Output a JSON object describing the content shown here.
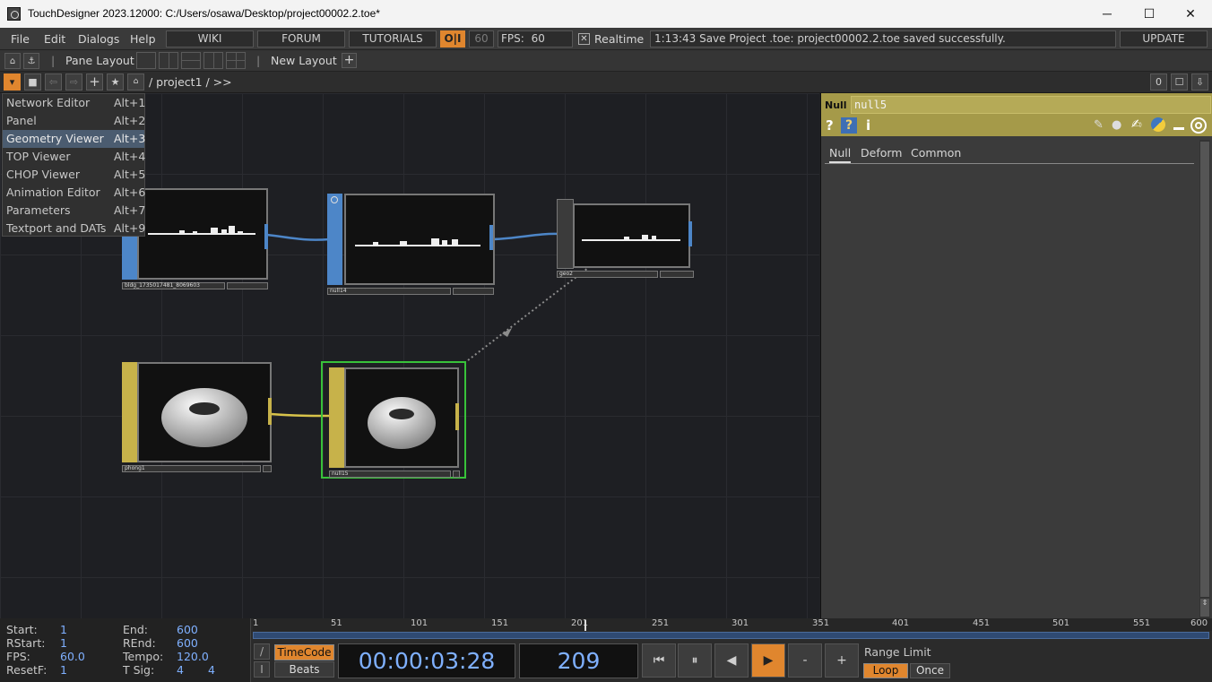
{
  "window": {
    "title": "TouchDesigner 2023.12000: C:/Users/osawa/Desktop/project00002.2.toe*",
    "minimize": "─",
    "maximize": "☐",
    "close": "✕"
  },
  "menu": {
    "file": "File",
    "edit": "Edit",
    "dialogs": "Dialogs",
    "help": "Help",
    "wiki": "WIKI",
    "forum": "FORUM",
    "tutorials": "TUTORIALS",
    "oi": "O|I",
    "fps_box": "60",
    "fps_label": "FPS:",
    "fps_value": "60",
    "realtime_check": "✕",
    "realtime": "Realtime",
    "status": "1:13:43 Save Project .toe: project00002.2.toe saved successfully.",
    "update": "UPDATE"
  },
  "layoutbar": {
    "pane_layout": "Pane Layout",
    "new_layout": "New Layout",
    "plus": "+"
  },
  "pathbar": {
    "path": "/ project1 / >>",
    "counter": "0"
  },
  "dialogs_menu": [
    {
      "label": "Network Editor",
      "key": "Alt+1"
    },
    {
      "label": "Panel",
      "key": "Alt+2"
    },
    {
      "label": "Geometry Viewer",
      "key": "Alt+3"
    },
    {
      "label": "TOP Viewer",
      "key": "Alt+4"
    },
    {
      "label": "CHOP Viewer",
      "key": "Alt+5"
    },
    {
      "label": "Animation Editor",
      "key": "Alt+6"
    },
    {
      "label": "Parameters",
      "key": "Alt+7"
    },
    {
      "label": "Textport and DATs",
      "key": "Alt+9"
    }
  ],
  "nodes": {
    "bldg": "bldg_1735017481_8069603",
    "null14": "null14",
    "geo2": "geo2",
    "phong1": "phong1",
    "null15": "null15"
  },
  "params": {
    "type": "Null",
    "name": "null5",
    "help1": "?",
    "help2": "?",
    "info": "i",
    "tabs": [
      "Null",
      "Deform",
      "Common"
    ]
  },
  "timebar": {
    "start_label": "Start:",
    "start": "1",
    "end_label": "End:",
    "end": "600",
    "rstart_label": "RStart:",
    "rstart": "1",
    "rend_label": "REnd:",
    "rend": "600",
    "fps_label": "FPS:",
    "fps": "60.0",
    "tempo_label": "Tempo:",
    "tempo": "120.0",
    "resetf_label": "ResetF:",
    "resetf": "1",
    "tsig_label": "T Sig:",
    "tsig_a": "4",
    "tsig_b": "4",
    "ticks": [
      "1",
      "51",
      "101",
      "151",
      "201",
      "251",
      "301",
      "351",
      "401",
      "451",
      "501",
      "551",
      "600"
    ],
    "timecode": "TimeCode",
    "beats": "Beats",
    "time": "00:00:03:28",
    "frame": "209",
    "range_limit": "Range Limit",
    "loop": "Loop",
    "once": "Once",
    "slash": "/",
    "bar": "I"
  },
  "colors": {
    "accent": "#e0862e",
    "param_header": "#a59a49",
    "sop_blue": "#4d86c8",
    "mat_yellow": "#c7b24a",
    "selected": "#38c23a"
  }
}
